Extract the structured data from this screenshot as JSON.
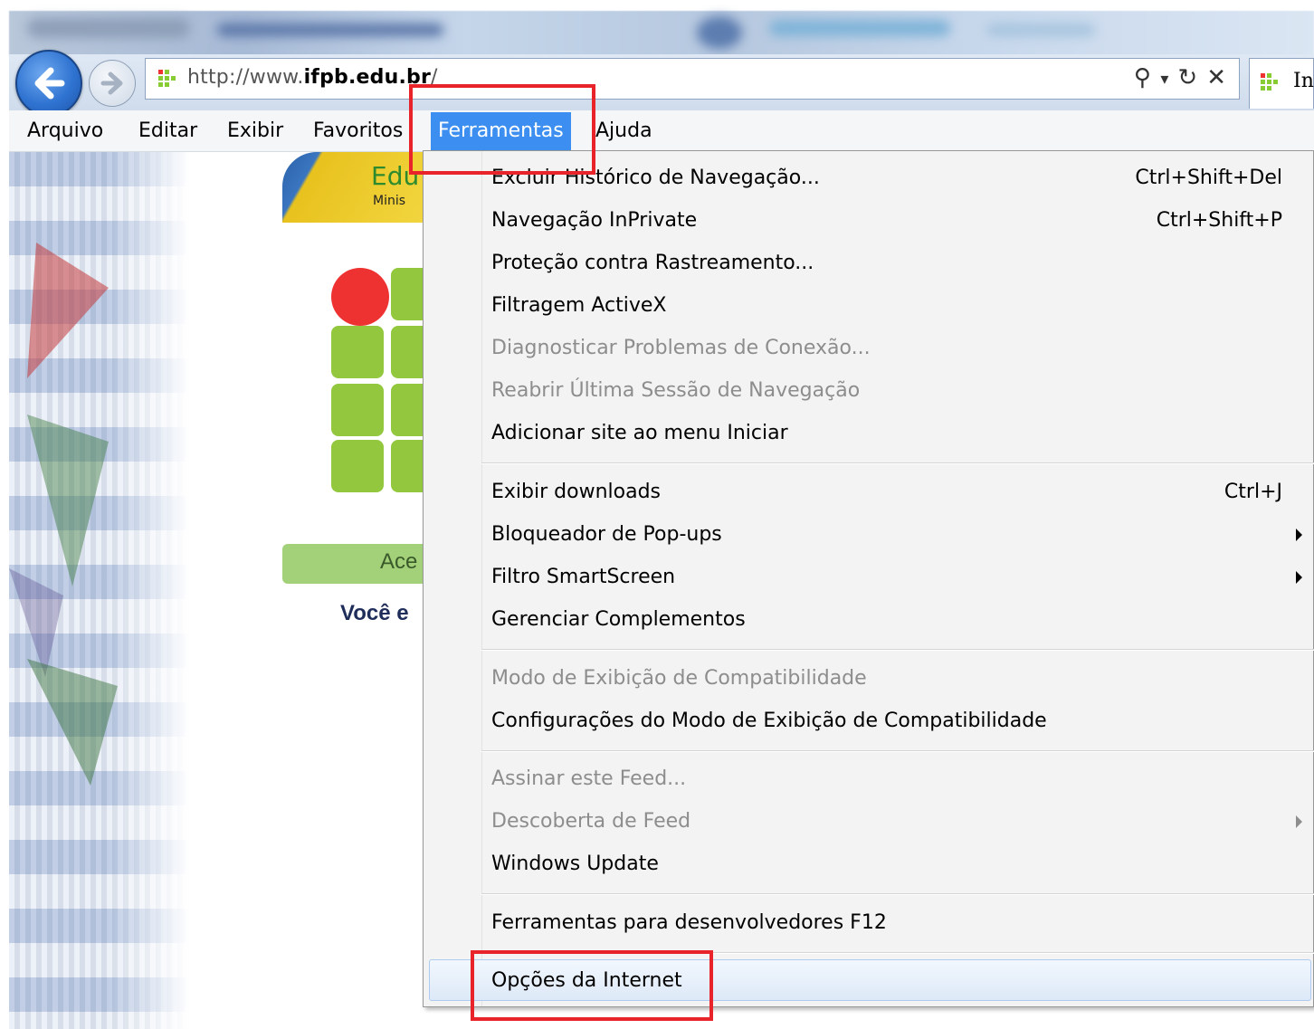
{
  "browser": {
    "url_prefix": "http://www.",
    "url_domain": "ifpb.edu.br",
    "url_suffix": "/",
    "tab_title_fragment": "In",
    "icons": [
      "back-arrow-icon",
      "forward-arrow-icon",
      "site-favicon",
      "search-icon",
      "refresh-icon",
      "close-icon"
    ],
    "search_dropdown_glyph": "▾",
    "refresh_glyph": "↻",
    "stop_glyph": "✕",
    "search_glyph": "⚲"
  },
  "menubar": {
    "items": [
      {
        "label": "Arquivo"
      },
      {
        "label": "Editar"
      },
      {
        "label": "Exibir"
      },
      {
        "label": "Favoritos"
      },
      {
        "label": "Ferramentas",
        "active": true
      },
      {
        "label": "Ajuda"
      }
    ]
  },
  "page": {
    "logo_text": "Edu",
    "logo_subtext": "Minis",
    "acesse_text": "Ace",
    "voce_text": "Você e"
  },
  "tools_menu": {
    "items": [
      {
        "label": "Excluir Histórico de Navegação...",
        "shortcut": "Ctrl+Shift+Del"
      },
      {
        "label": "Navegação InPrivate",
        "shortcut": "Ctrl+Shift+P"
      },
      {
        "label": "Proteção contra Rastreamento..."
      },
      {
        "label": "Filtragem ActiveX"
      },
      {
        "label": "Diagnosticar Problemas de Conexão...",
        "disabled": true
      },
      {
        "label": "Reabrir Última Sessão de Navegação",
        "disabled": true
      },
      {
        "label": "Adicionar site ao menu Iniciar"
      },
      {
        "label": "Exibir downloads",
        "shortcut": "Ctrl+J"
      },
      {
        "label": "Bloqueador de Pop-ups",
        "submenu": true
      },
      {
        "label": "Filtro SmartScreen",
        "submenu": true
      },
      {
        "label": "Gerenciar Complementos"
      },
      {
        "label": "Modo de Exibição de Compatibilidade",
        "disabled": true
      },
      {
        "label": "Configurações do Modo de Exibição de Compatibilidade"
      },
      {
        "label": "Assinar este Feed...",
        "disabled": true
      },
      {
        "label": "Descoberta de Feed",
        "disabled": true,
        "submenu": true
      },
      {
        "label": "Windows Update"
      },
      {
        "label": "Ferramentas para desenvolvedores F12"
      },
      {
        "label": "Opções da Internet",
        "hover": true
      }
    ]
  },
  "colors": {
    "highlight_red": "#e8232a",
    "menu_active_blue": "#3c8ff0",
    "disabled_text": "#8d8d8d",
    "logo_green": "#93c83e",
    "logo_red": "#ee3231"
  }
}
